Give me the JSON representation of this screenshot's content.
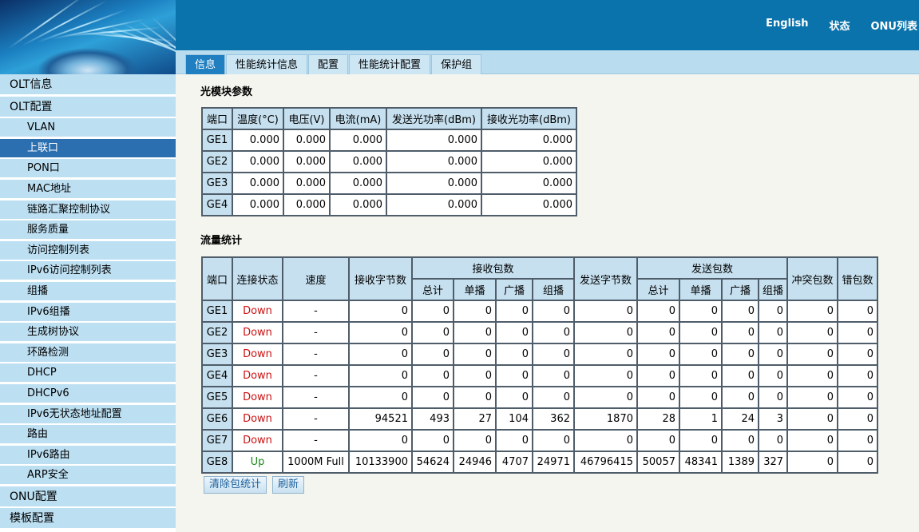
{
  "header": {
    "nav": [
      "English",
      "状态",
      "ONU列表"
    ]
  },
  "tabs": [
    "信息",
    "性能统计信息",
    "配置",
    "性能统计配置",
    "保护组"
  ],
  "sidebar": {
    "items": [
      {
        "label": "OLT信息",
        "level": 1
      },
      {
        "label": "OLT配置",
        "level": 1
      },
      {
        "label": "VLAN",
        "level": 2
      },
      {
        "label": "上联口",
        "level": 2,
        "active": true
      },
      {
        "label": "PON口",
        "level": 2
      },
      {
        "label": "MAC地址",
        "level": 2
      },
      {
        "label": "链路汇聚控制协议",
        "level": 2
      },
      {
        "label": "服务质量",
        "level": 2
      },
      {
        "label": "访问控制列表",
        "level": 2
      },
      {
        "label": "IPv6访问控制列表",
        "level": 2
      },
      {
        "label": "组播",
        "level": 2
      },
      {
        "label": "IPv6组播",
        "level": 2
      },
      {
        "label": "生成树协议",
        "level": 2
      },
      {
        "label": "环路检测",
        "level": 2
      },
      {
        "label": "DHCP",
        "level": 2
      },
      {
        "label": "DHCPv6",
        "level": 2
      },
      {
        "label": "IPv6无状态地址配置",
        "level": 2
      },
      {
        "label": "路由",
        "level": 2
      },
      {
        "label": "IPv6路由",
        "level": 2
      },
      {
        "label": "ARP安全",
        "level": 2
      },
      {
        "label": "ONU配置",
        "level": 1
      },
      {
        "label": "模板配置",
        "level": 1
      }
    ]
  },
  "optical": {
    "title": "光模块参数",
    "headers": [
      "端口",
      "温度(°C)",
      "电压(V)",
      "电流(mA)",
      "发送光功率(dBm)",
      "接收光功率(dBm)"
    ],
    "rows": [
      [
        "GE1",
        "0.000",
        "0.000",
        "0.000",
        "0.000",
        "0.000"
      ],
      [
        "GE2",
        "0.000",
        "0.000",
        "0.000",
        "0.000",
        "0.000"
      ],
      [
        "GE3",
        "0.000",
        "0.000",
        "0.000",
        "0.000",
        "0.000"
      ],
      [
        "GE4",
        "0.000",
        "0.000",
        "0.000",
        "0.000",
        "0.000"
      ]
    ]
  },
  "traffic": {
    "title": "流量统计",
    "headers": {
      "port": "端口",
      "link": "连接状态",
      "speed": "速度",
      "rx_bytes": "接收字节数",
      "rx_packets": "接收包数",
      "tx_bytes": "发送字节数",
      "tx_packets": "发送包数",
      "collision": "冲突包数",
      "error": "错包数",
      "sub": [
        "总计",
        "单播",
        "广播",
        "组播"
      ]
    },
    "rows": [
      {
        "port": "GE1",
        "link": "Down",
        "speed": "-",
        "rx_bytes": "0",
        "rx": [
          "0",
          "0",
          "0",
          "0"
        ],
        "tx_bytes": "0",
        "tx": [
          "0",
          "0",
          "0",
          "0"
        ],
        "collision": "0",
        "error": "0"
      },
      {
        "port": "GE2",
        "link": "Down",
        "speed": "-",
        "rx_bytes": "0",
        "rx": [
          "0",
          "0",
          "0",
          "0"
        ],
        "tx_bytes": "0",
        "tx": [
          "0",
          "0",
          "0",
          "0"
        ],
        "collision": "0",
        "error": "0"
      },
      {
        "port": "GE3",
        "link": "Down",
        "speed": "-",
        "rx_bytes": "0",
        "rx": [
          "0",
          "0",
          "0",
          "0"
        ],
        "tx_bytes": "0",
        "tx": [
          "0",
          "0",
          "0",
          "0"
        ],
        "collision": "0",
        "error": "0"
      },
      {
        "port": "GE4",
        "link": "Down",
        "speed": "-",
        "rx_bytes": "0",
        "rx": [
          "0",
          "0",
          "0",
          "0"
        ],
        "tx_bytes": "0",
        "tx": [
          "0",
          "0",
          "0",
          "0"
        ],
        "collision": "0",
        "error": "0"
      },
      {
        "port": "GE5",
        "link": "Down",
        "speed": "-",
        "rx_bytes": "0",
        "rx": [
          "0",
          "0",
          "0",
          "0"
        ],
        "tx_bytes": "0",
        "tx": [
          "0",
          "0",
          "0",
          "0"
        ],
        "collision": "0",
        "error": "0"
      },
      {
        "port": "GE6",
        "link": "Down",
        "speed": "-",
        "rx_bytes": "94521",
        "rx": [
          "493",
          "27",
          "104",
          "362"
        ],
        "tx_bytes": "1870",
        "tx": [
          "28",
          "1",
          "24",
          "3"
        ],
        "collision": "0",
        "error": "0"
      },
      {
        "port": "GE7",
        "link": "Down",
        "speed": "-",
        "rx_bytes": "0",
        "rx": [
          "0",
          "0",
          "0",
          "0"
        ],
        "tx_bytes": "0",
        "tx": [
          "0",
          "0",
          "0",
          "0"
        ],
        "collision": "0",
        "error": "0"
      },
      {
        "port": "GE8",
        "link": "Up",
        "speed": "1000M Full",
        "rx_bytes": "10133900",
        "rx": [
          "54624",
          "24946",
          "4707",
          "24971"
        ],
        "tx_bytes": "46796415",
        "tx": [
          "50057",
          "48341",
          "1389",
          "327"
        ],
        "collision": "0",
        "error": "0"
      }
    ]
  },
  "buttons": {
    "clear": "清除包统计",
    "refresh": "刷新"
  },
  "colors": {
    "header": "#0a73ab",
    "active_tab": "#1f7fc0",
    "sidebar_item": "#bcdff2",
    "sidebar_active": "#2b6fb0",
    "link_down": "#cc1111",
    "link_up": "#1a8a1a"
  }
}
